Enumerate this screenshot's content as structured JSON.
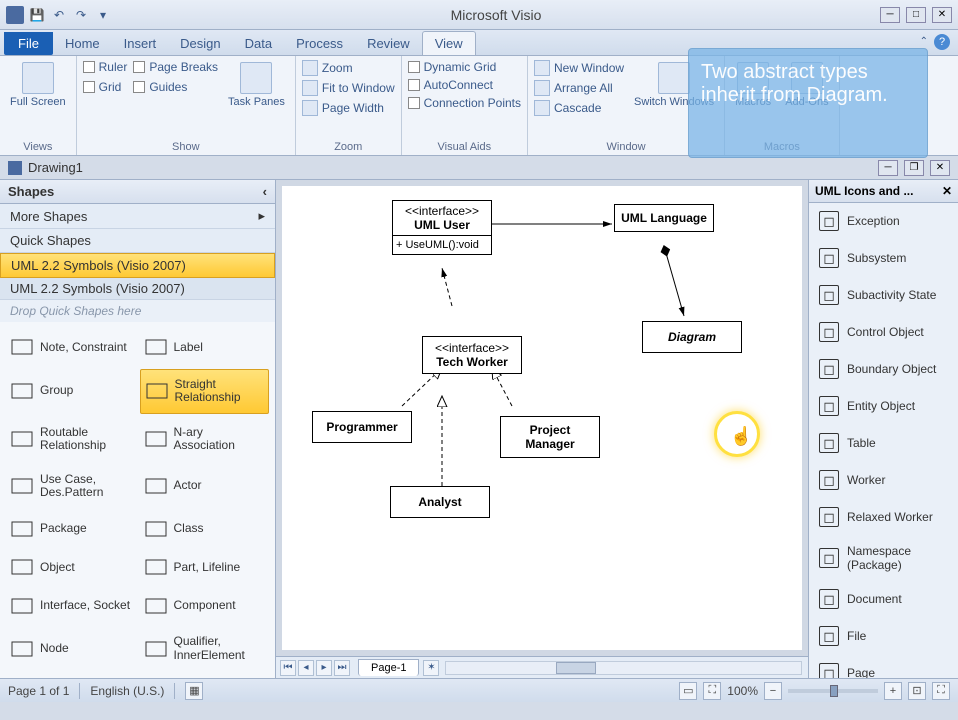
{
  "titlebar": {
    "app_title": "Microsoft Visio"
  },
  "tabs": {
    "file": "File",
    "items": [
      "Home",
      "Insert",
      "Design",
      "Data",
      "Process",
      "Review",
      "View"
    ],
    "active_index": 6
  },
  "ribbon": {
    "views": {
      "label": "Views",
      "full_screen": "Full Screen"
    },
    "show": {
      "label": "Show",
      "ruler": "Ruler",
      "grid": "Grid",
      "page_breaks": "Page Breaks",
      "guides": "Guides",
      "task_panes": "Task Panes"
    },
    "zoom": {
      "label": "Zoom",
      "zoom": "Zoom",
      "fit": "Fit to Window",
      "width": "Page Width"
    },
    "visual_aids": {
      "label": "Visual Aids",
      "dynamic_grid": "Dynamic Grid",
      "autoconnect": "AutoConnect",
      "conn_points": "Connection Points"
    },
    "window": {
      "label": "Window",
      "new": "New Window",
      "arrange": "Arrange All",
      "cascade": "Cascade",
      "switch": "Switch Windows"
    },
    "macros": {
      "label": "Macros",
      "macros": "Macros",
      "addons": "Add-Ons"
    }
  },
  "tooltip": {
    "text": "Two abstract types inherit from Diagram."
  },
  "doc": {
    "title": "Drawing1"
  },
  "shapes": {
    "title": "Shapes",
    "more": "More Shapes",
    "quick": "Quick Shapes",
    "stencil_selected": "UML 2.2 Symbols (Visio 2007)",
    "stencil_header": "UML 2.2 Symbols (Visio 2007)",
    "drop_hint": "Drop Quick Shapes here",
    "items": [
      {
        "label": "Note, Constraint"
      },
      {
        "label": "Label"
      },
      {
        "label": "Group"
      },
      {
        "label": "Straight Relationship",
        "selected": true
      },
      {
        "label": "Routable Relationship"
      },
      {
        "label": "N-ary Association"
      },
      {
        "label": "Use Case, Des.Pattern"
      },
      {
        "label": "Actor"
      },
      {
        "label": "Package"
      },
      {
        "label": "Class"
      },
      {
        "label": "Object"
      },
      {
        "label": "Part, Lifeline"
      },
      {
        "label": "Interface, Socket"
      },
      {
        "label": "Component"
      },
      {
        "label": "Node"
      },
      {
        "label": "Qualifier, InnerElement"
      }
    ]
  },
  "canvas": {
    "uml_user": {
      "stereo": "<<interface>>",
      "name": "UML User",
      "method": "+ UseUML():void"
    },
    "uml_language": {
      "name": "UML Language"
    },
    "diagram": {
      "name": "Diagram"
    },
    "tech_worker": {
      "stereo": "<<interface>>",
      "name": "Tech Worker"
    },
    "programmer": {
      "name": "Programmer"
    },
    "project_manager": {
      "name": "Project Manager"
    },
    "analyst": {
      "name": "Analyst"
    }
  },
  "page_tabs": {
    "page1": "Page-1"
  },
  "icons_panel": {
    "title": "UML Icons and ...",
    "items": [
      "Exception",
      "Subsystem",
      "Subactivity State",
      "Control Object",
      "Boundary Object",
      "Entity Object",
      "Table",
      "Worker",
      "Relaxed Worker",
      "Namespace (Package)",
      "Document",
      "File",
      "Page"
    ]
  },
  "status": {
    "page": "Page 1 of 1",
    "lang": "English (U.S.)",
    "zoom": "100%"
  }
}
